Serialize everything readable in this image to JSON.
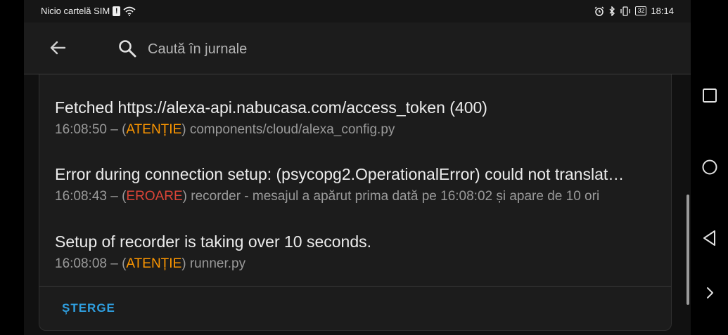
{
  "status_bar": {
    "carrier": "Nicio cartelă SIM",
    "sim_alert": "!",
    "battery": "32",
    "time": "18:14",
    "icons": [
      "sim-alert-icon",
      "wifi-icon",
      "alarm-icon",
      "bluetooth-icon",
      "vibrate-icon",
      "battery-icon"
    ]
  },
  "header": {
    "back_icon": "arrow-back-icon",
    "search_icon": "search-icon",
    "search_placeholder": "Caută în jurnale",
    "search_value": ""
  },
  "logs": [
    {
      "message": "Fetched https://alexa-api.nabucasa.com/access_token (400)",
      "time": "16:08:50",
      "level": "ATENȚIE",
      "level_color": "#ff9800",
      "source": "components/cloud/alexa_config.py"
    },
    {
      "message": "Error during connection setup: (psycopg2.OperationalError) could not translat…",
      "time": "16:08:43",
      "level": "EROARE",
      "level_color": "#db4437",
      "source": "recorder - mesajul a apărut prima dată pe 16:08:02 și apare de 10 ori"
    },
    {
      "message": "Setup of recorder is taking over 10 seconds.",
      "time": "16:08:08",
      "level": "ATENȚIE",
      "level_color": "#ff9800",
      "source": "runner.py"
    }
  ],
  "meta_separator": " – (",
  "meta_close": ")",
  "actions": {
    "clear_label": "ȘTERGE",
    "clear_color": "#2f9fe0"
  },
  "nav": {
    "icons": [
      "recent-apps-icon",
      "home-icon",
      "back-triangle-icon",
      "chevron-right-icon"
    ]
  }
}
